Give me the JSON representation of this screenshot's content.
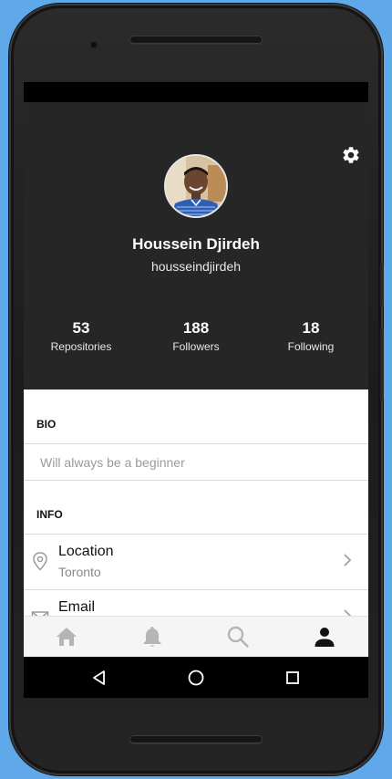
{
  "profile": {
    "display_name": "Houssein Djirdeh",
    "username": "housseindjirdeh",
    "settings_icon": "gear-icon",
    "stats": [
      {
        "value": "53",
        "label": "Repositories"
      },
      {
        "value": "188",
        "label": "Followers"
      },
      {
        "value": "18",
        "label": "Following"
      }
    ]
  },
  "bio": {
    "heading": "BIO",
    "text": "Will always be a beginner"
  },
  "info": {
    "heading": "INFO",
    "rows": [
      {
        "title": "Location",
        "subtitle": "Toronto",
        "icon": "location-pin-icon"
      },
      {
        "title": "Email",
        "subtitle": "",
        "icon": "mail-icon"
      }
    ]
  },
  "tabbar": {
    "tabs": [
      {
        "icon": "home-icon",
        "active": false
      },
      {
        "icon": "bell-icon",
        "active": false
      },
      {
        "icon": "search-icon",
        "active": false
      },
      {
        "icon": "person-icon",
        "active": true
      }
    ]
  },
  "navbar": {
    "buttons": [
      "back-icon",
      "home-circle-icon",
      "recents-icon"
    ]
  },
  "colors": {
    "background": "#5fa8ea",
    "profile_header": "#262626",
    "active_tab": "#111111",
    "inactive_tab": "#b5b5b5"
  }
}
